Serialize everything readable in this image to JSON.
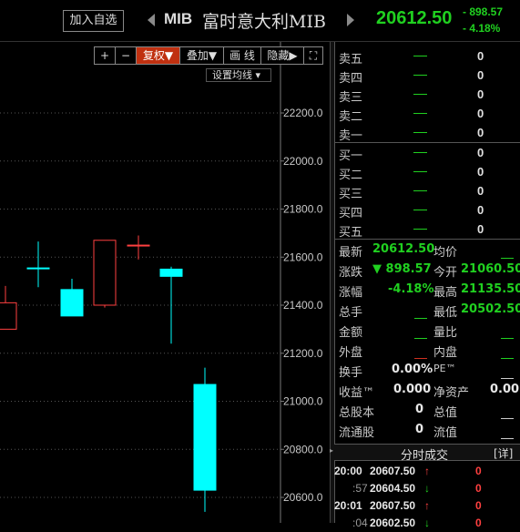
{
  "header": {
    "add_watch_label": "加入自选",
    "code": "MIB",
    "name": "富时意大利MIB",
    "price": "20612.50",
    "change": "- 898.57",
    "change_pct": "- 4.18%"
  },
  "toolbar": {
    "buttons": [
      "+",
      "−",
      "复权▼",
      "叠加▼",
      "画 线",
      "隐藏▶",
      "⛶"
    ]
  },
  "chart": {
    "set_ma_label": "设置均线 ▾",
    "y_axis_ticks": [
      "22200.0",
      "22000.0",
      "21800.0",
      "21600.0",
      "21400.0",
      "21200.0",
      "21000.0",
      "20800.0",
      "20600.0"
    ],
    "colors": {
      "up": "#ff4040",
      "down": "#00ffff"
    }
  },
  "chart_data": {
    "type": "candlestick",
    "ylim": [
      20500,
      22300
    ],
    "candles": [
      {
        "open": 21300,
        "close": 21410,
        "high": 21480,
        "low": 21300
      },
      {
        "open": 21555,
        "close": 21555,
        "high": 21665,
        "low": 21475
      },
      {
        "open": 21465,
        "close": 21355,
        "high": 21510,
        "low": 21355
      },
      {
        "open": 21400,
        "close": 21670,
        "high": 21670,
        "low": 21390
      },
      {
        "open": 21650,
        "close": 21650,
        "high": 21690,
        "low": 21590
      },
      {
        "open": 21550,
        "close": 21520,
        "high": 21560,
        "low": 21240
      },
      {
        "open": 21070,
        "close": 20630,
        "high": 21140,
        "low": 20540
      }
    ]
  },
  "orderbook": {
    "asks": [
      {
        "label": "卖五",
        "volume": "0"
      },
      {
        "label": "卖四",
        "volume": "0"
      },
      {
        "label": "卖三",
        "volume": "0"
      },
      {
        "label": "卖二",
        "volume": "0"
      },
      {
        "label": "卖一",
        "volume": "0"
      }
    ],
    "bids": [
      {
        "label": "买一",
        "volume": "0"
      },
      {
        "label": "买二",
        "volume": "0"
      },
      {
        "label": "买三",
        "volume": "0"
      },
      {
        "label": "买四",
        "volume": "0"
      },
      {
        "label": "买五",
        "volume": "0"
      }
    ]
  },
  "quote": {
    "latest_label": "最新",
    "latest": "20612.50",
    "avg_label": "均价",
    "chg_label": "涨跌",
    "chg": "▼ 898.57",
    "open_label": "今开",
    "open": "21060.50",
    "pct_label": "涨幅",
    "pct": "-4.18%",
    "high_label": "最高",
    "high": "21135.50",
    "vol_label": "总手",
    "low_label": "最低",
    "low": "20502.50",
    "amount_label": "金额",
    "ratio_label": "量比",
    "outer_label": "外盘",
    "inner_label": "内盘",
    "turnover_label": "换手",
    "turnover": "0.00%",
    "pe_label": "PE™",
    "eps_label": "收益™",
    "eps": "0.000",
    "nav_label": "净资产",
    "nav": "0.00",
    "shares_label": "总股本",
    "shares": "0",
    "mktcap_label": "总值",
    "float_label": "流通股",
    "float": "0",
    "float_val_label": "流值"
  },
  "ticks": {
    "title": "分时成交",
    "detail": "[详]",
    "rows": [
      {
        "time": "20:00",
        "price": "20607.50",
        "dir": "↑",
        "vol": "0"
      },
      {
        "time": ":57",
        "price": "20604.50",
        "dir": "↓",
        "vol": "0"
      },
      {
        "time": "20:01",
        "price": "20607.50",
        "dir": "↑",
        "vol": "0"
      },
      {
        "time": ":04",
        "price": "20602.50",
        "dir": "↓",
        "vol": "0"
      }
    ]
  }
}
